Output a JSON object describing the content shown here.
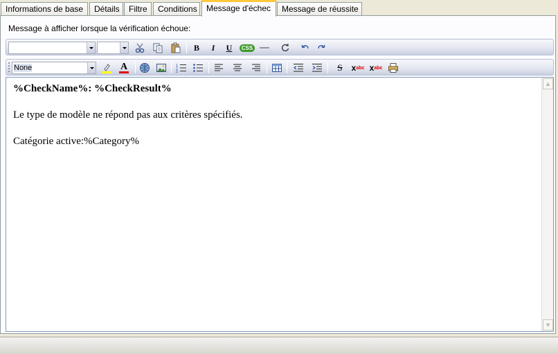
{
  "tabs": [
    {
      "label": "Informations de base",
      "active": false
    },
    {
      "label": "Détails",
      "active": false
    },
    {
      "label": "Filtre",
      "active": false
    },
    {
      "label": "Conditions",
      "active": false
    },
    {
      "label": "Message d'échec",
      "active": true
    },
    {
      "label": "Message de réussite",
      "active": false
    }
  ],
  "prompt": "Message à afficher lorsque la vérification échoue:",
  "toolbar1": {
    "font_name_value": "",
    "font_size_value": "",
    "icons": [
      "cut-icon",
      "copy-icon",
      "paste-icon",
      "bold-icon",
      "italic-icon",
      "underline-icon",
      "css-icon",
      "horizontal-rule-icon",
      "refresh-icon",
      "undo-icon",
      "redo-icon"
    ],
    "bold_label": "B",
    "italic_label": "I",
    "underline_label": "U",
    "css_label": "CSS"
  },
  "toolbar2": {
    "style_value": "None",
    "icons": [
      "highlight-color-icon",
      "font-color-icon",
      "insert-link-icon",
      "insert-image-icon",
      "numbered-list-icon",
      "bullet-list-icon",
      "align-left-icon",
      "align-center-icon",
      "align-right-icon",
      "insert-table-icon",
      "outdent-icon",
      "indent-icon",
      "strikethrough-icon",
      "superscript-icon",
      "subscript-icon",
      "print-icon"
    ],
    "font_color_label": "A",
    "strike_label": "S",
    "sup_label": "abc",
    "sub_label": "abc"
  },
  "editor": {
    "heading": "%CheckName%: %CheckResult%",
    "line1": "Le type de modèle ne répond pas aux critères spécifiés.",
    "line2": "Catégorie active:%Category%"
  },
  "colors": {
    "active_tab_accent": "#ffc83c",
    "highlight_yellow": "#ffff00",
    "font_color_red": "#e00000",
    "css_badge_green": "#3c9a2a"
  }
}
